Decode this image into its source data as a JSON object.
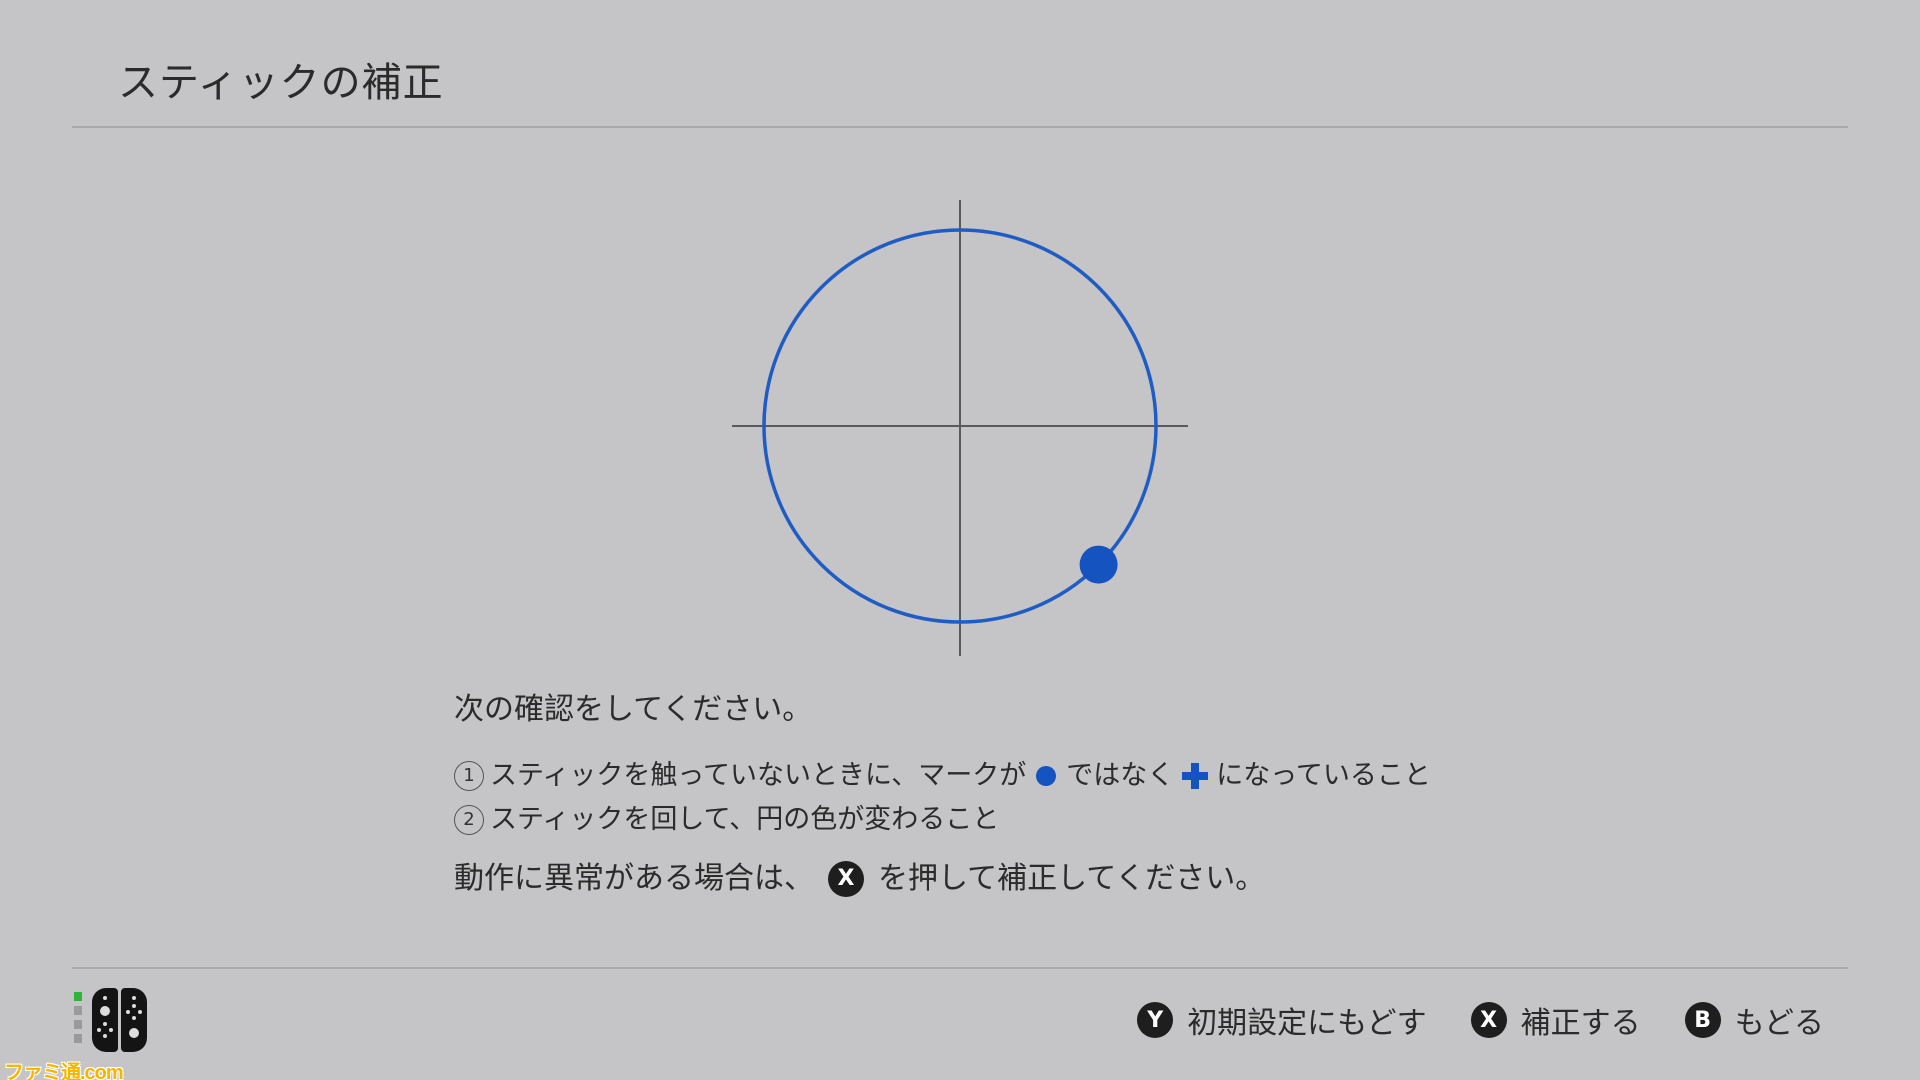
{
  "header": {
    "title": "スティックの補正"
  },
  "diagram": {
    "circle_color": "#1f5cc3",
    "axis_color": "#5a5a5a",
    "marker_color": "#1553c0",
    "marker_angle_deg": 315
  },
  "instructions": {
    "lead": "次の確認をしてください。",
    "step1": {
      "number": "1",
      "text_before": "スティックを触っていないときに、マークが",
      "text_middle": "ではなく",
      "text_after": "になっていること"
    },
    "step2": {
      "number": "2",
      "text": "スティックを回して、円の色が変わること"
    },
    "warning": {
      "text_before": "動作に異常がある場合は、",
      "button": "X",
      "text_after": "を押して補正してください。"
    }
  },
  "footer": {
    "buttons": [
      {
        "key": "Y",
        "label": "初期設定にもどす"
      },
      {
        "key": "X",
        "label": "補正する"
      },
      {
        "key": "B",
        "label": "もどる"
      }
    ],
    "player_leds": [
      true,
      false,
      false,
      false
    ]
  },
  "watermark": "ファミ通.com"
}
